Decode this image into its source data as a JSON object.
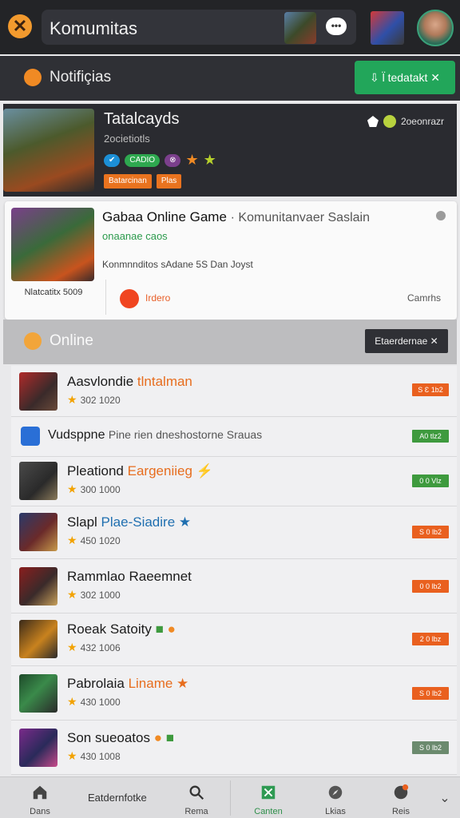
{
  "header": {
    "title": "Komumitas",
    "logo_icon": "x-logo-icon",
    "chat_icon": "chat-bubble-icon"
  },
  "notifications": {
    "label": "Notifiçias",
    "button_label": "⇩ l̈ tedatakt ✕"
  },
  "featured": {
    "title": "Tatalcayds",
    "subtitle": "2ocietiotls",
    "meta": "2oeonrazr",
    "badges": [
      "✔",
      "CADIO",
      "⊗"
    ],
    "tags": [
      "Batarcinan",
      "Plas"
    ]
  },
  "game_card": {
    "title": "Gabaa Online Game",
    "title_suffix": "· Komunitanvaer Saslain",
    "subtitle": "onaanae caos",
    "info_line": "Konmnnditos sAdane 5S Dan Joyst",
    "image_caption": "Nlatcatitx 5009",
    "action_label": "Irdero",
    "comments_label": "Camrhs"
  },
  "online": {
    "label": "Online",
    "button_label": "Etaerdernae ✕"
  },
  "rows": [
    {
      "title": "Aasvlondie",
      "accent": "tlntalman",
      "rating": "302 1020",
      "badge": "S Ɛ 1b2",
      "badge_style": "orange"
    },
    {
      "title": "Vudsppne",
      "accent": "",
      "extra": "Pine rien dneshostorne Srauas",
      "rating": "",
      "badge": "A0 tlz2",
      "badge_style": "green"
    },
    {
      "title": "Pleationd",
      "accent": "Eargeniieg ⚡",
      "rating": "300 1000",
      "badge": "0 0 Vlz",
      "badge_style": "green"
    },
    {
      "title": "Slapl",
      "accent": "Plae-Siadire ★",
      "rating": "450 1020",
      "badge": "S 0 lb2",
      "badge_style": "orange"
    },
    {
      "title": "Rammlao Raeemnet",
      "accent": "",
      "rating": "302 1000",
      "badge": "0 0 lb2",
      "badge_style": "orange"
    },
    {
      "title": "Roeak Satoity",
      "accent": "",
      "rating": "432 1006",
      "badge": "2 0 lbz",
      "badge_style": "orange"
    },
    {
      "title": "Pabrolaia",
      "accent": "Liname ★",
      "rating": "430 1000",
      "badge": "S 0 lb2",
      "badge_style": "orange"
    },
    {
      "title": "Son",
      "accent": "",
      "extra": "sueoatos",
      "rating": "430 1008",
      "badge": "S 0 lb2",
      "badge_style": "sage"
    }
  ],
  "bottom_nav": {
    "home": "Dans",
    "middle": "Eatdernfotke",
    "search": "Rema",
    "active": "Canten",
    "compass": "Lkias",
    "profile": "Reis"
  },
  "colors": {
    "accent_green": "#22a65a",
    "accent_orange": "#e9601f",
    "dark_bg": "#232427"
  }
}
